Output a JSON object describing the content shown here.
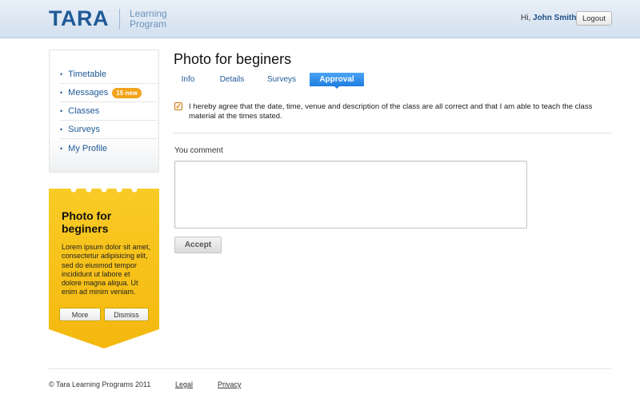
{
  "header": {
    "logo": "TARA",
    "logo_sub_line1": "Learning",
    "logo_sub_line2": "Program",
    "greeting": "Hi,",
    "user_name": "John Smith",
    "logout_label": "Logout"
  },
  "sidebar": {
    "items": [
      {
        "label": "Timetable"
      },
      {
        "label": "Messages",
        "badge": "15 new"
      },
      {
        "label": "Classes"
      },
      {
        "label": "Surveys"
      },
      {
        "label": "My Profile"
      }
    ]
  },
  "promo": {
    "title": "Photo for beginers",
    "text": "Lorem ipsum dolor sit amet, consectetur adipisicing elit, sed do eiusmod tempor incididunt ut labore et dolore magna aliqua. Ut enim ad minim veniam.",
    "more_label": "More",
    "dismiss_label": "Dismiss"
  },
  "main": {
    "title": "Photo for beginers",
    "tabs": [
      {
        "label": "Info",
        "active": false
      },
      {
        "label": "Details",
        "active": false
      },
      {
        "label": "Surveys",
        "active": false
      },
      {
        "label": "Approval",
        "active": true
      }
    ],
    "agreement_checked": true,
    "agreement_text": "I hereby agree that the date, time, venue and description of the class are all correct and that I am able to teach the class material at the times stated.",
    "comment_label": "You comment",
    "comment_value": "",
    "accept_label": "Accept"
  },
  "footer": {
    "copyright": "© Tara Learning Programs 2011",
    "legal": "Legal",
    "privacy": "Privacy"
  },
  "colors": {
    "brand": "#1f5a96",
    "accent_tab": "#1f7fe0",
    "promo_yellow": "#f7c21a",
    "badge": "#f2a31b"
  }
}
